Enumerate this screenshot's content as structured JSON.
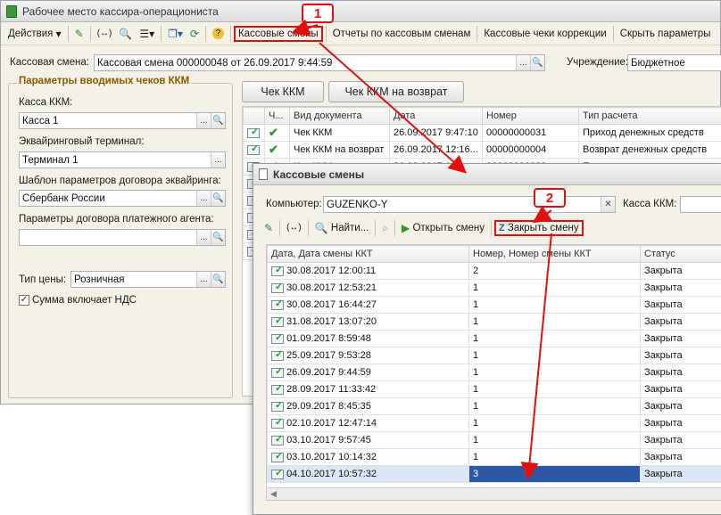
{
  "main": {
    "title": "Рабочее место кассира-операциониста",
    "toolbar": {
      "actions": "Действия",
      "kassovye_smeny": "Кассовые смены",
      "otchety": "Отчеты по кассовым сменам",
      "cheki_korr": "Кассовые чеки коррекции",
      "params": "Скрыть параметры"
    },
    "shift_label": "Кассовая смена:",
    "shift_value": "Кассовая смена 000000048 от 26.09.2017 9:44:59",
    "institution_label": "Учреждение:",
    "institution_value": "Бюджетное",
    "params_group_title": "Параметры вводимых чеков ККМ",
    "kkm_label": "Касса ККМ:",
    "kkm_value": "Касса 1",
    "terminal_label": "Эквайринговый терминал:",
    "terminal_value": "Терминал 1",
    "template_label": "Шаблон параметров договора эквайринга:",
    "template_value": "Сбербанк России",
    "agent_label": "Параметры договора платежного агента:",
    "agent_value": "",
    "price_type_label": "Тип цены:",
    "price_type_value": "Розничная",
    "vat_label": "Сумма включает НДС",
    "btn_check": "Чек ККМ",
    "btn_return": "Чек ККМ на возврат",
    "grid": {
      "headers": [
        "Ч...",
        "Вид документа",
        "Дата",
        "Номер",
        "Тип расчета"
      ],
      "rows": [
        {
          "type": "Чек ККМ",
          "date": "26.09.2017 9:47:10",
          "num": "00000000031",
          "calc": "Приход денежных средств"
        },
        {
          "type": "Чек ККМ на возврат",
          "date": "26.09.2017 12:16...",
          "num": "00000000004",
          "calc": "Возврат денежных средств"
        },
        {
          "type": "Чек ККМ",
          "date": "26.09.2017 12:...",
          "num": "00000000032",
          "calc": "Приход денежных средств"
        }
      ]
    }
  },
  "dialog": {
    "title": "Кассовые смены",
    "computer_label": "Компьютер:",
    "computer_value": "GUZENKO-Y",
    "kkm_label": "Касса ККМ:",
    "toolbar": {
      "find": "Найти...",
      "open": "Открыть смену",
      "close": "Закрыть смену"
    },
    "headers": [
      "Дата, Дата смены ККТ",
      "Номер, Номер смены ККТ",
      "Статус"
    ],
    "rows": [
      {
        "date": "30.08.2017 12:00:11",
        "num": "2",
        "status": "Закрыта"
      },
      {
        "date": "30.08.2017 12:53:21",
        "num": "1",
        "status": "Закрыта"
      },
      {
        "date": "30.08.2017 16:44:27",
        "num": "1",
        "status": "Закрыта"
      },
      {
        "date": "31.08.2017 13:07:20",
        "num": "1",
        "status": "Закрыта"
      },
      {
        "date": "01.09.2017 8:59:48",
        "num": "1",
        "status": "Закрыта"
      },
      {
        "date": "25.09.2017 9:53:28",
        "num": "1",
        "status": "Закрыта"
      },
      {
        "date": "26.09.2017 9:44:59",
        "num": "1",
        "status": "Закрыта"
      },
      {
        "date": "28.09.2017 11:33:42",
        "num": "1",
        "status": "Закрыта"
      },
      {
        "date": "29.09.2017 8:45:35",
        "num": "1",
        "status": "Закрыта"
      },
      {
        "date": "02.10.2017 12:47:14",
        "num": "1",
        "status": "Закрыта"
      },
      {
        "date": "03.10.2017 9:57:45",
        "num": "1",
        "status": "Закрыта"
      },
      {
        "date": "03.10.2017 10:14:32",
        "num": "1",
        "status": "Закрыта"
      },
      {
        "date": "04.10.2017 10:57:32",
        "num": "3",
        "status": "Закрыта"
      }
    ]
  },
  "callouts": {
    "one": "1",
    "two": "2"
  },
  "colors": {
    "accent_red": "#e01010",
    "selection": "#2c58a8"
  }
}
